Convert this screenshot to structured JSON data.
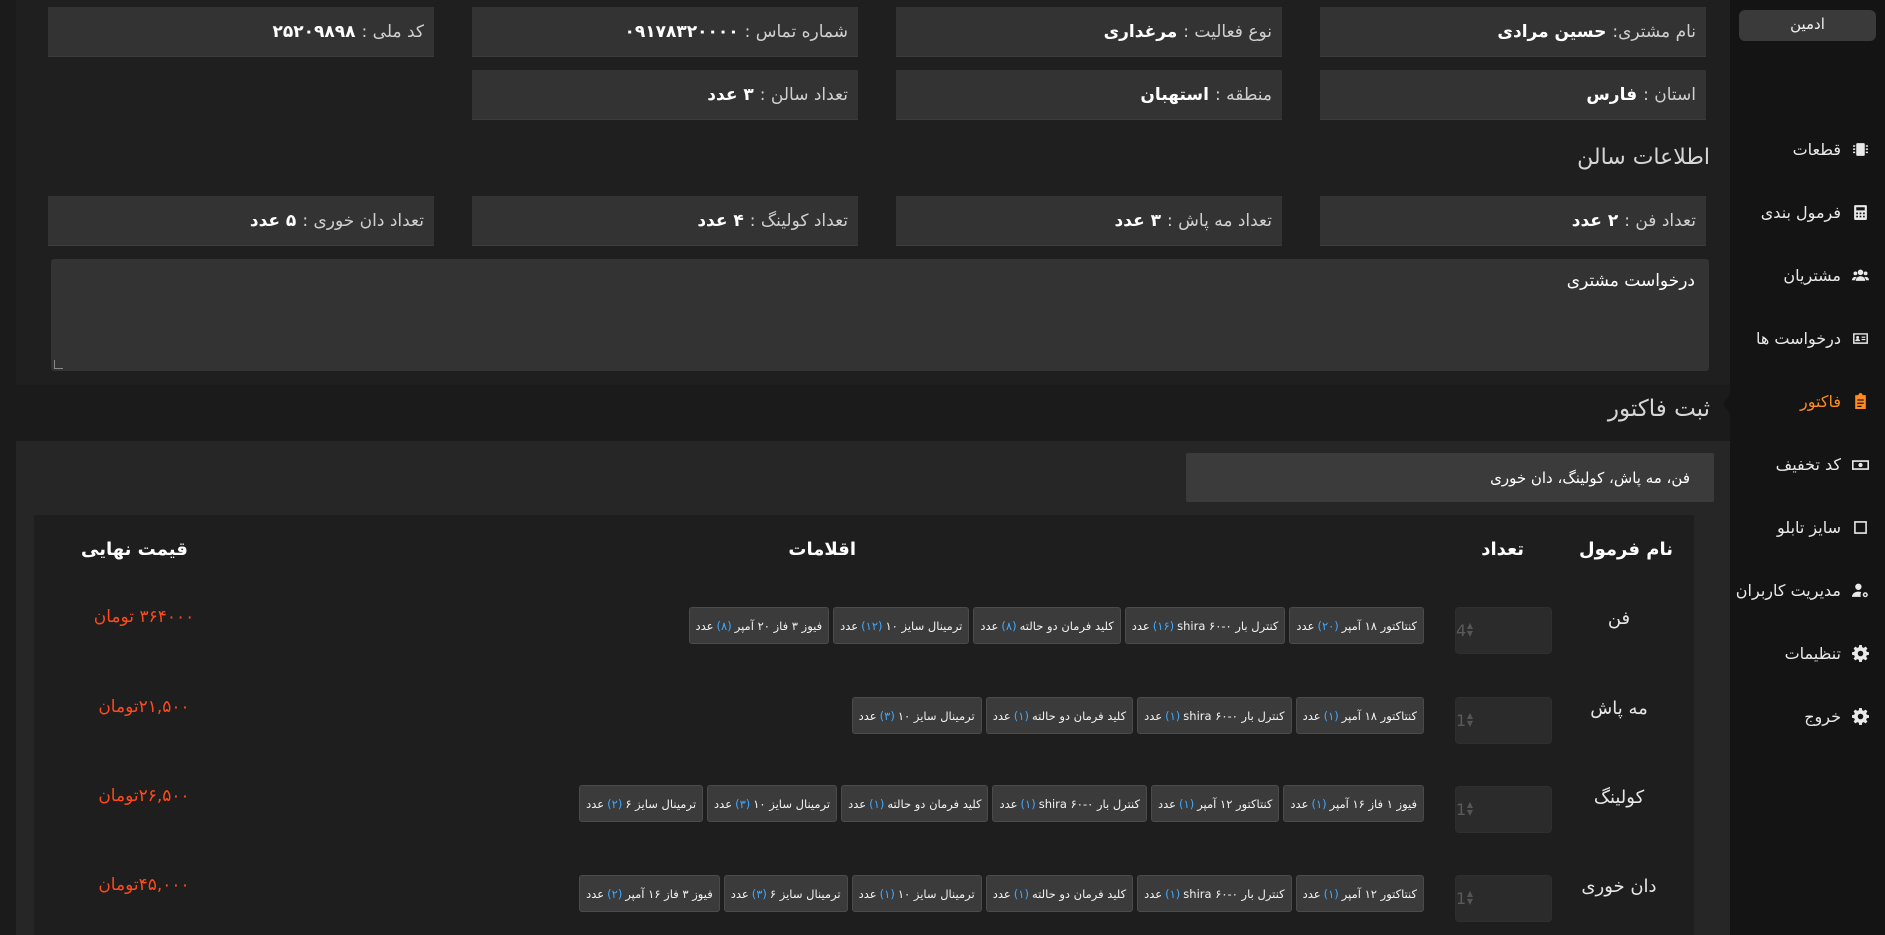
{
  "sidebar": {
    "admin": "ادمین",
    "items": [
      {
        "label": "قطعات",
        "icon": "chip-icon"
      },
      {
        "label": "فرمول بندی",
        "icon": "calculator-icon"
      },
      {
        "label": "مشتریان",
        "icon": "users-icon"
      },
      {
        "label": "درخواست ها",
        "icon": "id-card-icon"
      },
      {
        "label": "فاکتور",
        "icon": "clipboard-icon",
        "active": true
      },
      {
        "label": "کد تخفیف",
        "icon": "money-icon"
      },
      {
        "label": "سایز تابلو",
        "icon": "square-icon"
      },
      {
        "label": "مدیریت کاربران",
        "icon": "user-gear-icon"
      },
      {
        "label": "تنظیمات",
        "icon": "gear-icon"
      },
      {
        "label": "خروج",
        "icon": "gear-icon"
      }
    ],
    "active_color": "#ff8a1e"
  },
  "customer": {
    "name_label": "نام مشتری:",
    "name_value": "حسین مرادی",
    "activity_label": "نوع فعالیت :",
    "activity_value": "مرغداری",
    "phone_label": "شماره تماس :",
    "phone_value": "۰۹۱۷۸۳۲۰۰۰۰",
    "national_id_label": "کد ملی :",
    "national_id_value": "۲۵۲۰۹۸۹۸",
    "province_label": "استان :",
    "province_value": "فارس",
    "region_label": "منطقه :",
    "region_value": "استهبان",
    "hall_count_label": "تعداد سالن :",
    "hall_count_value": "۳ عدد"
  },
  "hall_info": {
    "title": "اطلاعات سالن",
    "fan_label": "تعداد فن :",
    "fan_value": "۲ عدد",
    "mist_label": "تعداد مه پاش :",
    "mist_value": "۳ عدد",
    "cooling_label": "تعداد کولینگ :",
    "cooling_value": "۴ عدد",
    "feeder_label": "تعداد دان خوری :",
    "feeder_value": "۵ عدد",
    "request_label": "درخواست مشتری"
  },
  "invoice": {
    "title": "ثبت فاکتور",
    "selected_formulas": "فن، مه پاش، کولینگ، دان خوری",
    "headers": {
      "formula_name": "نام فرمول",
      "quantity": "تعداد",
      "items": "اقلامات",
      "final_price": "قیمت نهایی"
    },
    "rows": [
      {
        "name": "فن",
        "quantity": "4",
        "items": [
          {
            "name": "کنتاکتور ۱۸ آمپر",
            "count": "(۲۰)",
            "unit": "عدد"
          },
          {
            "name": "کنترل بار shira ۶۰-۰",
            "count": "(۱۶)",
            "unit": "عدد"
          },
          {
            "name": "کلید فرمان دو حالته",
            "count": "(۸)",
            "unit": "عدد"
          },
          {
            "name": "ترمینال سایز ۱۰",
            "count": "(۱۲)",
            "unit": "عدد"
          },
          {
            "name": "فیوز ۳ فاز ۲۰ آمپر",
            "count": "(۸)",
            "unit": "عدد"
          }
        ],
        "price": "۳۶۴۰۰۰ تومان"
      },
      {
        "name": "مه پاش",
        "quantity": "1",
        "items": [
          {
            "name": "کنتاکتور ۱۸ آمپر",
            "count": "(۱)",
            "unit": "عدد"
          },
          {
            "name": "کنترل بار shira ۶۰-۰",
            "count": "(۱)",
            "unit": "عدد"
          },
          {
            "name": "کلید فرمان دو حالته",
            "count": "(۱)",
            "unit": "عدد"
          },
          {
            "name": "ترمینال سایز ۱۰",
            "count": "(۳)",
            "unit": "عدد"
          }
        ],
        "price": "۲۱,۵۰۰تومان"
      },
      {
        "name": "کولینگ",
        "quantity": "1",
        "items": [
          {
            "name": "فیوز ۱ فاز ۱۶ آمپر",
            "count": "(۱)",
            "unit": "عدد"
          },
          {
            "name": "کنتاکتور ۱۲ آمپر",
            "count": "(۱)",
            "unit": "عدد"
          },
          {
            "name": "کنترل بار shira ۶۰-۰",
            "count": "(۱)",
            "unit": "عدد"
          },
          {
            "name": "کلید فرمان دو حالته",
            "count": "(۱)",
            "unit": "عدد"
          },
          {
            "name": "ترمینال سایز ۱۰",
            "count": "(۳)",
            "unit": "عدد"
          },
          {
            "name": "ترمینال سایز ۶",
            "count": "(۲)",
            "unit": "عدد"
          }
        ],
        "price": "۲۶,۵۰۰تومان"
      },
      {
        "name": "دان خوری",
        "quantity": "1",
        "items": [
          {
            "name": "کنتاکتور ۱۲ آمپر",
            "count": "(۱)",
            "unit": "عدد"
          },
          {
            "name": "کنترل بار shira ۶۰-۰",
            "count": "(۱)",
            "unit": "عدد"
          },
          {
            "name": "کلید فرمان دو حالته",
            "count": "(۱)",
            "unit": "عدد"
          },
          {
            "name": "ترمینال سایز ۱۰",
            "count": "(۱)",
            "unit": "عدد"
          },
          {
            "name": "ترمینال سایز ۶",
            "count": "(۳)",
            "unit": "عدد"
          },
          {
            "name": "فیوز ۳ فاز ۱۶ آمپر",
            "count": "(۲)",
            "unit": "عدد"
          }
        ],
        "price": "۴۵,۰۰۰تومان"
      }
    ],
    "price_color": "#ff4a1c",
    "count_color": "#3fa8ff"
  }
}
